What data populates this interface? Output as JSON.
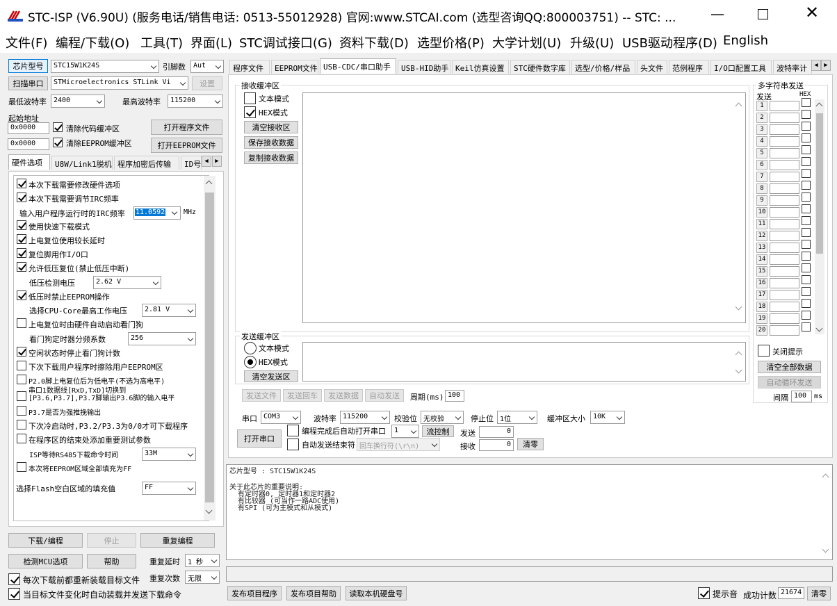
{
  "window": {
    "title": "STC-ISP (V6.90U) (服务电话/销售电话: 0513-55012928) 官网:www.STCAI.com  (选型咨询QQ:800003751) -- STC: ..."
  },
  "menu": [
    "文件(F)",
    "编程/下载(O)",
    "工具(T)",
    "界面(L)",
    "STC调试接口(G)",
    "资料下载(D)",
    "选型价格(P)",
    "大学计划(U)",
    "升级(U)",
    "USB驱动程序(D)",
    "English"
  ],
  "left": {
    "chip_btn": "芯片型号",
    "chip_value": "STC15W1K24S",
    "pins_label": "引脚数",
    "pins_value": "Aut",
    "scan_btn": "扫描串口",
    "port_value": "STMicroelectronics STLink Vi",
    "settings_btn": "设置",
    "min_baud_label": "最低波特率",
    "min_baud_value": "2400",
    "max_baud_label": "最高波特率",
    "max_baud_value": "115200",
    "start_addr_label": "起始地址",
    "addr1": "0x0000",
    "clear_code": "清除代码缓冲区",
    "open_prog": "打开程序文件",
    "addr2": "0x0000",
    "clear_eeprom": "清除EEPROM缓冲区",
    "open_eeprom": "打开EEPROM文件",
    "tabs": [
      "硬件选项",
      "U8W/Link1脱机",
      "程序加密后传输",
      "ID号"
    ],
    "options": {
      "o1": "本次下载需要修改硬件选项",
      "o2": "本次下载需要调节IRC频率",
      "irc_label": "输入用户程序运行时的IRC频率",
      "irc_value": "11.0592",
      "irc_unit": "MHz",
      "o3": "使用快速下载模式",
      "o4": "上电复位使用较长延时",
      "o5": "复位脚用作I/O口",
      "o6": "允许低压复位(禁止低压中断)",
      "lv_label": "低压检测电压",
      "lv_value": "2.62 V",
      "o7": "低压时禁止EEPROM操作",
      "cpu_label": "选择CPU-Core最高工作电压",
      "cpu_value": "2.81 V",
      "o8": "上电复位时由硬件自动启动看门狗",
      "wdt_label": "看门狗定时器分频系数",
      "wdt_value": "256",
      "o9": "空闲状态时停止看门狗计数",
      "o10": "下次下载用户程序时擦除用户EEPROM区",
      "o11": "P2.0脚上电复位后为低电平(不选为高电平)",
      "o12a": "串口1数据线[RxD,TxD]切换到",
      "o12b": "[P3.6,P3.7],P3.7脚输出P3.6脚的输入电平",
      "o13": "P3.7是否为强推挽输出",
      "o14": "下次冷启动时,P3.2/P3.3为0/0才可下载程序",
      "o15": "在程序区的结束处添加重要测试参数",
      "isp_label": "ISP等待RS485下载命令时间",
      "isp_value": "33M",
      "o16": "本次将EEPROM区域全部填充为FF",
      "flash_label": "选择Flash空白区域的填充值",
      "flash_value": "FF"
    },
    "download_btn": "下载/编程",
    "stop_btn": "停止",
    "reprog_btn": "重复编程",
    "check_mcu_btn": "检测MCU选项",
    "help_btn": "帮助",
    "repeat_delay_label": "重复延时",
    "repeat_delay_value": "1 秒",
    "repeat_count_label": "重复次数",
    "repeat_count_value": "无限",
    "reload_each": "每次下载前都重新装载目标文件",
    "auto_reload": "当目标文件变化时自动装载并发送下载命令"
  },
  "right": {
    "tabs": [
      "程序文件",
      "EEPROM文件",
      "USB-CDC/串口助手",
      "USB-HID助手",
      "Keil仿真设置",
      "STC硬件数字库",
      "选型/价格/样品",
      "头文件",
      "范例程序",
      "I/O口配置工具",
      "波特率计"
    ],
    "recv_group": "接收缓冲区",
    "text_mode": "文本模式",
    "hex_mode": "HEX模式",
    "clear_recv": "清空接收区",
    "save_recv": "保存接收数据",
    "copy_recv": "复制接收数据",
    "send_group": "发送缓冲区",
    "clear_send": "清空发送区",
    "send_file": "发送文件",
    "send_enter": "发送回车",
    "send_data": "发送数据",
    "auto_send": "自动发送",
    "period_label": "周期(ms)",
    "period_value": "100",
    "multi_title": "多字符串发送",
    "multi_send": "发送",
    "multi_hex": "HEX",
    "multi_rows": [
      "1",
      "2",
      "3",
      "4",
      "5",
      "6",
      "7",
      "8",
      "9",
      "10",
      "11",
      "12",
      "13",
      "14",
      "15",
      "16",
      "17",
      "18",
      "19",
      "20"
    ],
    "close_tip": "关闭提示",
    "clear_all": "清空全部数据",
    "auto_loop": "自动循环发送",
    "interval_label": "间隔",
    "interval_value": "100",
    "interval_unit": "ms",
    "port_label": "串口",
    "port_value": "COM3",
    "baud_label": "波特率",
    "baud_value": "115200",
    "parity_label": "校验位",
    "parity_value": "无校验",
    "stop_label": "停止位",
    "stop_value": "1位",
    "bufsize_label": "缓冲区大小",
    "bufsize_value": "10K",
    "open_port": "打开串口",
    "auto_open": "编程完成后自动打开串口",
    "auto_open_value": "1",
    "flow_ctrl": "流控制",
    "send_count_label": "发送",
    "send_count": "0",
    "auto_end": "自动发送结束符",
    "end_char": "回车换行符(\\r\\n)",
    "recv_count_label": "接收",
    "recv_count": "0",
    "clear_count": "清零"
  },
  "info": {
    "line1": "芯片型号 : STC15W1K24S",
    "line2": "关于此芯片的重要说明:",
    "line3": "  有定时器0, 定时器1和定时器2",
    "line4": "  有比较器 (可当作一路ADC使用)",
    "line5": "  有SPI (可为主模式和从模式)"
  },
  "bottom": {
    "publish_prog": "发布项目程序",
    "publish_help": "发布项目帮助",
    "read_disk": "读取本机硬盘号",
    "beep": "提示音",
    "success_label": "成功计数",
    "success_count": "21674",
    "clear": "清零"
  }
}
